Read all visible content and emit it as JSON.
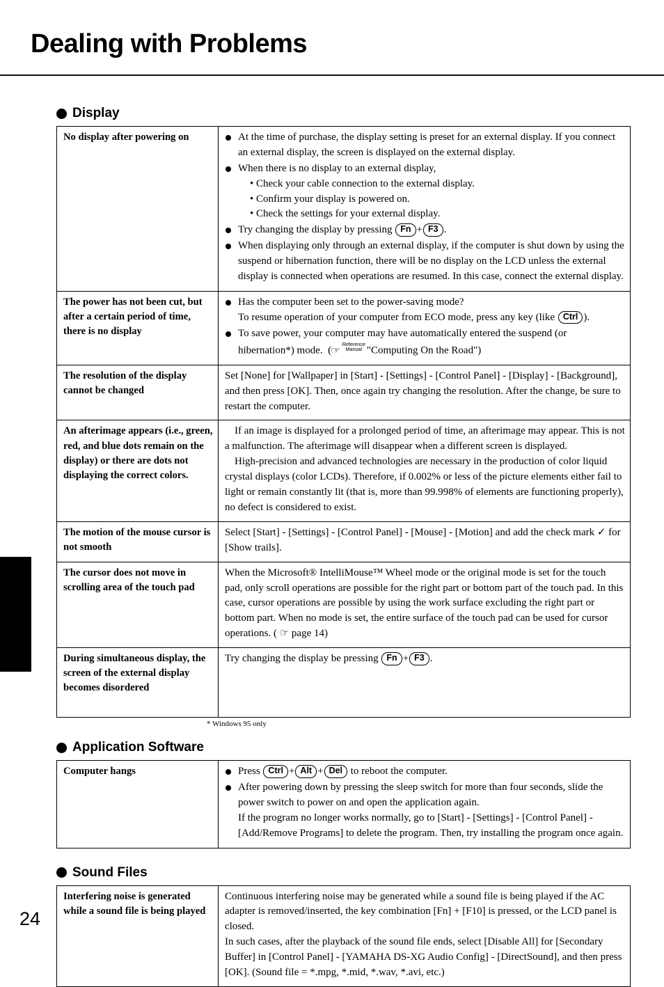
{
  "page": {
    "title": "Dealing with Problems",
    "number": "24"
  },
  "sections": [
    {
      "heading": "Display",
      "footnote": "* Windows 95 only",
      "rows": [
        {
          "symptom": "No display after powering on",
          "lines": [
            "At the time of purchase, the display setting is preset for an external display.  If you connect an external display, the screen is displayed on the external display.",
            "When there is no display to an external display,",
            "• Check your cable connection to the external display.",
            "• Confirm your display is powered on.",
            "• Check the settings for your external display.",
            "Try changing the display by pressing (Fn)+(F3).",
            "When displaying only through an external display, if the computer is shut down by using the suspend or hibernation function, there will be no display on the LCD unless the external display is connected when operations are resumed.  In this case, connect the external display."
          ]
        },
        {
          "symptom": "The power has not been cut, but after a certain period of time, there is no display",
          "lines": [
            "Has the computer been set to the power-saving mode?",
            "To resume operation of your computer from ECO mode, press any key (like (Ctrl)).",
            "To save power, your computer may have automatically entered  the suspend (or hibernation*) mode.  ( ☞ Reference Manual \"Computing On the Road\")"
          ]
        },
        {
          "symptom": "The resolution of the display cannot be changed",
          "lines": [
            "Set [None] for [Wallpaper] in [Start] - [Settings] - [Control Panel] - [Display] - [Background], and then press [OK].  Then, once again try changing the resolution.  After the change, be sure to restart the computer."
          ]
        },
        {
          "symptom": "An afterimage appears (i.e., green, red, and blue dots remain on the display) or there are dots not displaying the correct colors.",
          "lines": [
            "If an image is displayed for a prolonged period of time, an afterimage may appear.  This is not a malfunction.  The afterimage will disappear when a different screen is displayed.",
            "High-precision and advanced technologies are necessary in the production of color liquid crystal displays (color LCDs).  Therefore, if 0.002% or less of the picture elements either fail to light or remain constantly lit (that is, more than 99.998% of elements are functioning properly), no defect is considered to exist."
          ]
        },
        {
          "symptom": "The motion of the mouse cursor is not smooth",
          "lines": [
            "Select [Start] - [Settings] - [Control Panel] - [Mouse] - [Motion] and add the check mark ✓ for [Show trails]."
          ]
        },
        {
          "symptom": "The cursor does not move in scrolling area of the touch pad",
          "lines": [
            "When the Microsoft® IntelliMouse™ Wheel mode or the original mode is set for the touch pad, only scroll operations are possible for the right part or bottom part of the touch pad.  In this case, cursor operations are possible by using the work surface excluding the right part or bottom part.  When no mode is set, the entire surface of the touch pad can be used for cursor operations.  ( ☞ page 14)"
          ]
        },
        {
          "symptom": "During simultaneous display, the screen of the external display becomes disordered",
          "lines": [
            "Try changing the display be pressing (Fn)+(F3)."
          ]
        }
      ]
    },
    {
      "heading": "Application Software",
      "rows": [
        {
          "symptom": "Computer hangs",
          "lines": [
            "Press (Ctrl)+(Alt)+(Del) to reboot the computer.",
            "After powering down by pressing the sleep switch for more than four seconds, slide the power switch to power on and open the application again.",
            "If the program no longer works normally, go to [Start] - [Settings] - [Control Panel] - [Add/Remove Programs] to delete the program.  Then, try installing the program once again."
          ]
        }
      ]
    },
    {
      "heading": "Sound Files",
      "rows": [
        {
          "symptom": "Interfering noise is generated while a sound file is being played",
          "lines": [
            "Continuous interfering noise may be generated while a sound file is being played if the AC adapter is removed/inserted, the key combination [Fn] + [F10] is pressed, or the LCD panel is closed.",
            "In such cases, after the playback of the sound file ends, select [Disable All] for [Secondary Buffer] in [Control Panel] - [YAMAHA  DS-XG Audio Config] - [DirectSound], and then press [OK].          (Sound file = *.mpg, *.mid, *.wav, *.avi, etc.)"
          ]
        }
      ]
    }
  ],
  "keycaps": {
    "fn": "Fn",
    "f3": "F3",
    "ctrl": "Ctrl",
    "alt": "Alt",
    "del": "Del"
  },
  "reference_manual": {
    "line1": "Reference",
    "line2": "Manual"
  },
  "colors": {
    "ink": "#000000",
    "paper": "#ffffff"
  }
}
